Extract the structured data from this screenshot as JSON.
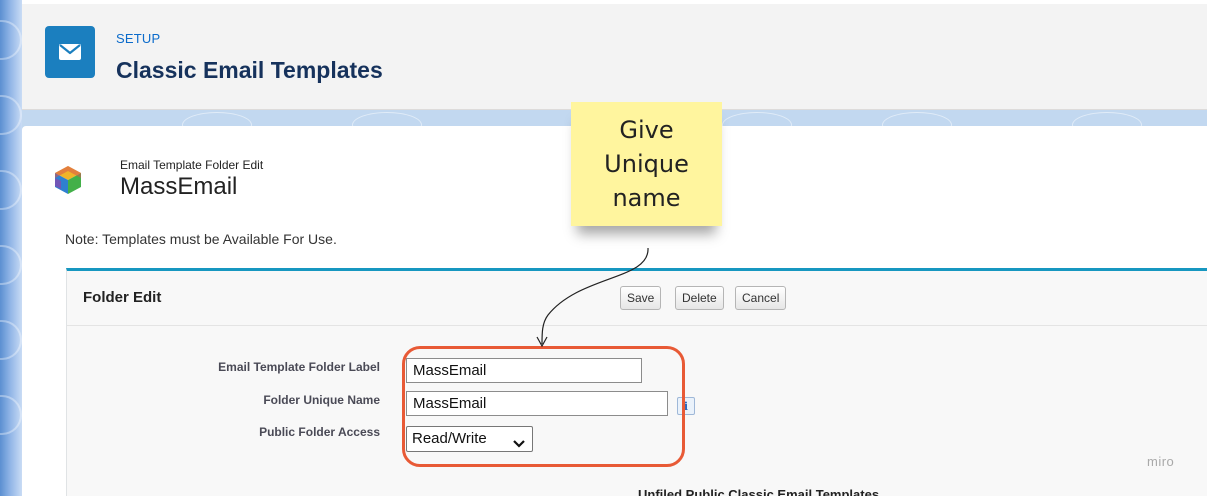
{
  "header": {
    "setup_label": "SETUP",
    "page_title": "Classic Email Templates",
    "icon": "envelope-icon"
  },
  "folder_header": {
    "small_label": "Email Template Folder Edit",
    "title": "MassEmail",
    "icon": "folder-cube-icon"
  },
  "note": "Note: Templates must be Available For Use.",
  "panel": {
    "title": "Folder Edit",
    "buttons": {
      "save": "Save",
      "delete": "Delete",
      "cancel": "Cancel"
    },
    "fields": {
      "folder_label": {
        "label": "Email Template Folder Label",
        "value": "MassEmail"
      },
      "unique_name": {
        "label": "Folder Unique Name",
        "value": "MassEmail"
      },
      "access": {
        "label": "Public Folder Access",
        "value": "Read/Write"
      }
    },
    "info_icon_glyph": "i"
  },
  "sticky_note": {
    "lines": [
      "Give",
      "Unique",
      "name"
    ],
    "color": "#fff59e"
  },
  "highlight_color": "#e85a36",
  "watermark": "miro",
  "cutoff_text": "Unfiled Public Classic Email Templates"
}
